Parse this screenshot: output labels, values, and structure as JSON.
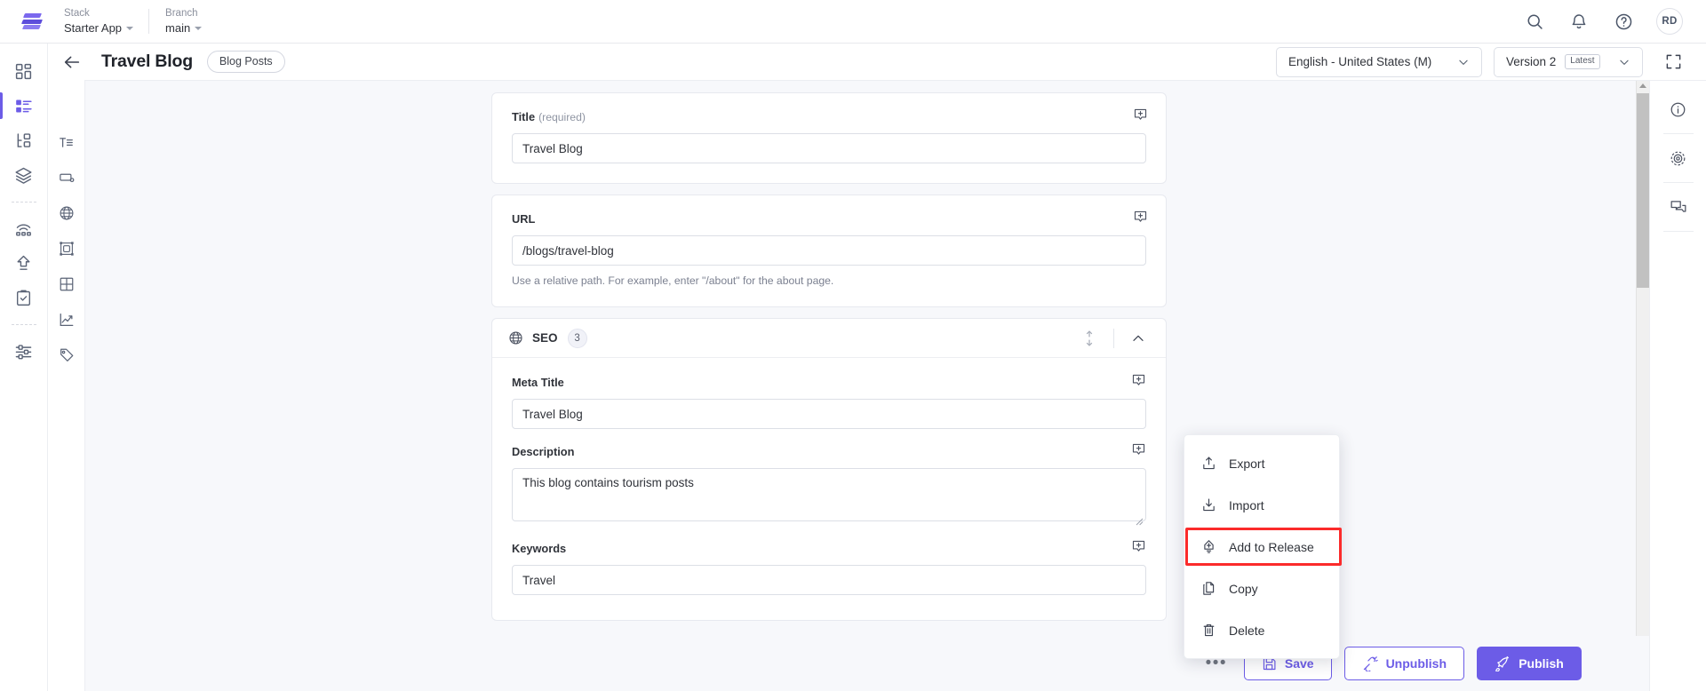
{
  "topbar": {
    "logo_name": "contentstack-logo",
    "stack": {
      "label": "Stack",
      "value": "Starter App"
    },
    "branch": {
      "label": "Branch",
      "value": "main"
    },
    "search_icon": "search-icon",
    "bell_icon": "notification-bell-icon",
    "help_icon": "help-circle-icon",
    "avatar_initials": "RD"
  },
  "subheader": {
    "back_icon": "arrow-left-icon",
    "title": "Travel Blog",
    "content_type_pill": "Blog Posts",
    "locale_select": {
      "value": "English - United States (M)"
    },
    "version_select": {
      "value": "Version 2",
      "badge": "Latest"
    },
    "fullscreen_icon": "fullscreen-icon"
  },
  "left_rail": [
    {
      "name": "sidebar-item-dashboard",
      "icon": "dashboard-grid-icon",
      "active": false
    },
    {
      "name": "sidebar-item-entries",
      "icon": "content-entries-icon",
      "active": true
    },
    {
      "name": "sidebar-item-content-models",
      "icon": "content-model-icon",
      "active": false
    },
    {
      "name": "sidebar-item-assets",
      "icon": "layers-stack-icon",
      "active": false
    },
    {
      "name": "sidebar-item-environments",
      "icon": "environments-wifi-icon",
      "active": false
    },
    {
      "name": "sidebar-item-publish-queue",
      "icon": "upload-arrow-icon",
      "active": false
    },
    {
      "name": "sidebar-item-releases",
      "icon": "clipboard-check-icon",
      "active": false
    },
    {
      "name": "sidebar-item-settings",
      "icon": "sliders-settings-icon",
      "active": false
    }
  ],
  "field_rail": [
    {
      "name": "field-type-text",
      "icon": "text-field-icon"
    },
    {
      "name": "field-type-number",
      "icon": "number-field-icon"
    },
    {
      "name": "field-type-link",
      "icon": "globe-link-icon"
    },
    {
      "name": "field-type-media",
      "icon": "media-frame-icon"
    },
    {
      "name": "field-type-group",
      "icon": "grid-group-icon"
    },
    {
      "name": "field-type-chart",
      "icon": "line-chart-icon"
    },
    {
      "name": "field-type-tag",
      "icon": "tag-icon"
    }
  ],
  "form": {
    "title_field": {
      "label": "Title",
      "required_text": "(required)",
      "value": "Travel Blog",
      "placeholder": "",
      "comment_icon": "add-comment-icon"
    },
    "url_field": {
      "label": "URL",
      "value": "/blogs/travel-blog",
      "placeholder": "",
      "help": "Use a relative path. For example, enter \"/about\" for the about page.",
      "comment_icon": "add-comment-icon"
    },
    "seo_group": {
      "icon": "globe-icon",
      "title": "SEO",
      "count": "3",
      "reorder_icon": "reorder-updown-icon",
      "collapse_icon": "chevron-up-icon",
      "fields": [
        {
          "name": "meta-title",
          "label": "Meta Title",
          "value": "Travel Blog",
          "type": "input",
          "comment_icon": "add-comment-icon"
        },
        {
          "name": "description",
          "label": "Description",
          "value": "This blog contains tourism posts",
          "type": "textarea",
          "comment_icon": "add-comment-icon"
        },
        {
          "name": "keywords",
          "label": "Keywords",
          "value": "Travel",
          "type": "input",
          "comment_icon": "add-comment-icon"
        }
      ]
    }
  },
  "context_menu": {
    "items": [
      {
        "label": "Export",
        "icon": "export-upload-icon",
        "highlighted": false
      },
      {
        "label": "Import",
        "icon": "import-download-icon",
        "highlighted": false
      },
      {
        "label": "Add to Release",
        "icon": "add-to-release-icon",
        "highlighted": true
      },
      {
        "label": "Copy",
        "icon": "copy-pages-icon",
        "highlighted": false
      },
      {
        "label": "Delete",
        "icon": "trash-delete-icon",
        "highlighted": false
      }
    ],
    "highlight_color": "#fb2b2b"
  },
  "bottom_bar": {
    "more_label": "•••",
    "save": {
      "label": "Save",
      "icon": "floppy-save-icon"
    },
    "unpublish": {
      "label": "Unpublish",
      "icon": "unplug-unpublish-icon"
    },
    "publish": {
      "label": "Publish",
      "icon": "rocket-publish-icon"
    }
  },
  "right_rail": [
    {
      "name": "right-rail-info",
      "icon": "info-circle-icon"
    },
    {
      "name": "right-rail-versions",
      "icon": "target-circles-icon"
    },
    {
      "name": "right-rail-comments",
      "icon": "comments-bubbles-icon"
    }
  ],
  "colors": {
    "accent": "#6c5ce7",
    "canvas": "#f7f8fb",
    "border": "#e7e9ef",
    "highlight": "#fb2b2b"
  }
}
